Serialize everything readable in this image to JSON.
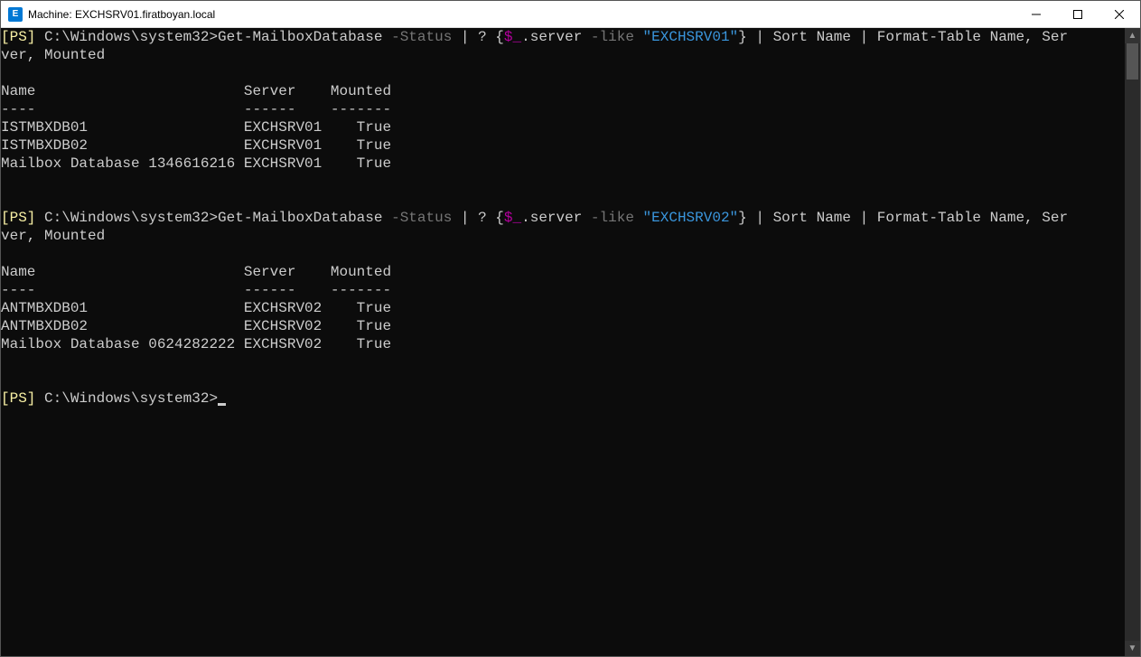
{
  "window": {
    "icon_label": "E",
    "title": "Machine: EXCHSRV01.firatboyan.local",
    "controls": {
      "minimize": "min",
      "maximize": "max",
      "close": "close"
    }
  },
  "scrollbar": {
    "up": "▲",
    "down": "▼"
  },
  "prompts": {
    "ps_tag": "[PS]",
    "path": " C:\\Windows\\system32>",
    "cmd": "Get-MailboxDatabase",
    "status_flag": " -Status",
    "pipe_q": " | ? {",
    "var": "$_",
    "server_prop": ".server",
    "like": " -like",
    "srv01": " \"EXCHSRV01\"",
    "srv02": " \"EXCHSRV02\"",
    "brace": "}",
    "sort_pipe": " | Sort",
    "sort_arg": " Name",
    "ft_pipe": " | Format-Table",
    "ft_args": " Name, Ser",
    "wrap_line": "ver, Mounted"
  },
  "table_header": {
    "name": "Name",
    "server": "Server",
    "mounted": "Mounted",
    "dash_name": "----",
    "dash_server": "------",
    "dash_mounted": "-------"
  },
  "block1_rows": [
    {
      "name": "ISTMBXDB01",
      "server": "EXCHSRV01",
      "mounted": "True"
    },
    {
      "name": "ISTMBXDB02",
      "server": "EXCHSRV01",
      "mounted": "True"
    },
    {
      "name": "Mailbox Database 1346616216",
      "server": "EXCHSRV01",
      "mounted": "True"
    }
  ],
  "block2_rows": [
    {
      "name": "ANTMBXDB01",
      "server": "EXCHSRV02",
      "mounted": "True"
    },
    {
      "name": "ANTMBXDB02",
      "server": "EXCHSRV02",
      "mounted": "True"
    },
    {
      "name": "Mailbox Database 0624282222",
      "server": "EXCHSRV02",
      "mounted": "True"
    }
  ],
  "colors": {
    "ps_tag": "#f9f1a5",
    "path": "#cccccc",
    "flag": "#767676",
    "string": "#3a96dd",
    "var": "#b4009e"
  }
}
